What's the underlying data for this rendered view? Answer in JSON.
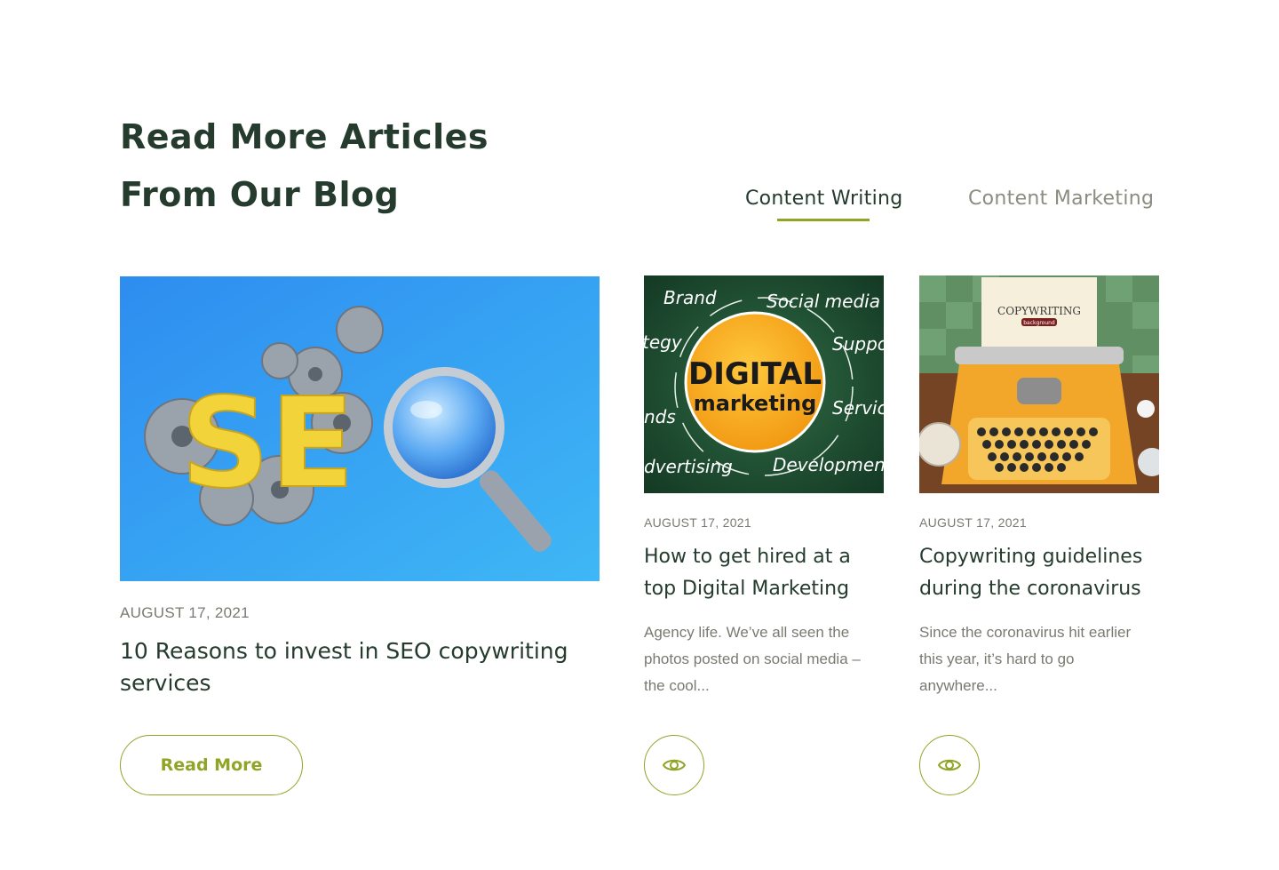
{
  "section": {
    "heading_line1": "Read More Articles",
    "heading_line2": "From Our Blog"
  },
  "tabs": [
    {
      "label": "Content Writing",
      "active": true
    },
    {
      "label": "Content Marketing",
      "active": false
    }
  ],
  "colors": {
    "heading": "#243b2d",
    "accent": "#8fa526",
    "muted": "#7a7a72"
  },
  "posts": [
    {
      "date": "AUGUST 17, 2021",
      "title": "10 Reasons to invest in SEO copywriting services",
      "image": {
        "icon": "seo-magnifier-image",
        "text": "SEO"
      },
      "button_label": "Read More"
    },
    {
      "date": "AUGUST 17, 2021",
      "title_line1": "How to get hired at a",
      "title_line2": "top Digital Marketing",
      "excerpt_line1": "Agency life. We’ve all seen the",
      "excerpt_line2": "photos posted on social media –",
      "excerpt_line3": "the cool...",
      "image": {
        "icon": "digital-marketing-chalkboard-image",
        "words": [
          "Brand",
          "Social media",
          "tegy",
          "Suppo",
          "nds",
          "Servic",
          "dvertising",
          "Development"
        ],
        "center_line1": "DIGITAL",
        "center_line2": "marketing"
      },
      "button_icon": "eye-icon"
    },
    {
      "date": "AUGUST 17, 2021",
      "title_line1": "Copywriting guidelines",
      "title_line2": "during the coronavirus",
      "excerpt_line1": "Since the coronavirus hit earlier",
      "excerpt_line2": "this year, it’s hard to go",
      "excerpt_line3": "anywhere...",
      "image": {
        "icon": "typewriter-image",
        "paper_title": "COPYWRITING",
        "paper_sub": "background"
      },
      "button_icon": "eye-icon"
    }
  ]
}
